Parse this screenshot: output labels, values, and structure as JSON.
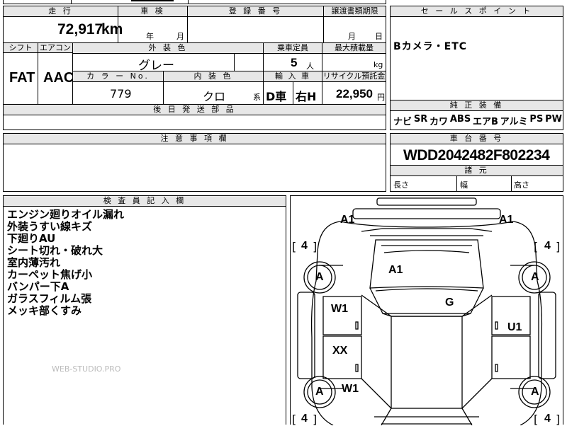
{
  "top_left_partial": "",
  "row1": {
    "mileage_label": "走 行",
    "mileage_value": "72,917",
    "mileage_unit": "km",
    "shaken_label": "車 検",
    "shaken_year": "年",
    "shaken_month": "月",
    "reg_label": "登 録 番 号",
    "transfer_label": "譲渡書類期限",
    "transfer_month": "月",
    "transfer_day": "日"
  },
  "row2": {
    "shift_label": "シフト",
    "shift_value": "FAT",
    "aircon_label": "エアコン",
    "aircon_value": "AAC",
    "exterior_label": "外 装 色",
    "exterior_value": "グレー",
    "capacity_label": "乗車定員",
    "capacity_value": "5",
    "capacity_unit": "人",
    "load_label": "最大積載量",
    "load_unit": "kg"
  },
  "row3": {
    "color_no_label": "カ ラ ー No.",
    "color_no_value": "779",
    "interior_label": "内 装 色",
    "interior_value": "クロ",
    "interior_suffix": "系",
    "import_label": "輸 入 車",
    "import_value": "D車",
    "handle_value": "右H",
    "recycle_label": "リサイクル預託金",
    "recycle_value": "22,950",
    "recycle_unit": "円"
  },
  "later_parts_label": "後 日 発 送 部 品",
  "sales_point": {
    "label": "セ ー ル ス ポ イ ン ト",
    "text": "Bカメラ・ETC"
  },
  "equipment": {
    "label": "純 正 装 備",
    "items": [
      "ナビ",
      "SR",
      "カワ",
      "ABS",
      "エアB",
      "アルミ",
      "PS",
      "PW"
    ]
  },
  "caution_label": "注 意 事 項 欄",
  "chassis": {
    "label": "車 台 番 号",
    "value": "WDD2042482F802234"
  },
  "dimensions": {
    "label": "諸 元",
    "length": "長さ",
    "width": "幅",
    "height": "高さ"
  },
  "inspector": {
    "label": "検 査 員 記 入 欄",
    "remarks": [
      "エンジン廻りオイル漏れ",
      "外装うすい線キズ",
      "下廻りAU",
      "シート切れ・破れ大",
      "室内薄汚れ",
      "カーペット焦げ小",
      "バンパー下A",
      "ガラスフィルム張",
      "メッキ部くすみ"
    ]
  },
  "watermark": "WEB-STUDIO.PRO",
  "diagram": {
    "marks": {
      "front_left": "A1",
      "front_right": "A1",
      "hood": "A1",
      "windshield": "G",
      "front_door_left": "W1",
      "rear_door_left": "XX",
      "rear_fender_left": "W1",
      "rear_door_right": "U1",
      "wheel_fl": "A",
      "wheel_fr": "A",
      "wheel_rl": "A",
      "wheel_rr": "A"
    },
    "tire_front_left": "4",
    "tire_front_right": "4",
    "tire_rear_left": "4",
    "tire_rear_right": "4",
    "bracket_open": "[",
    "bracket_close": "]"
  }
}
